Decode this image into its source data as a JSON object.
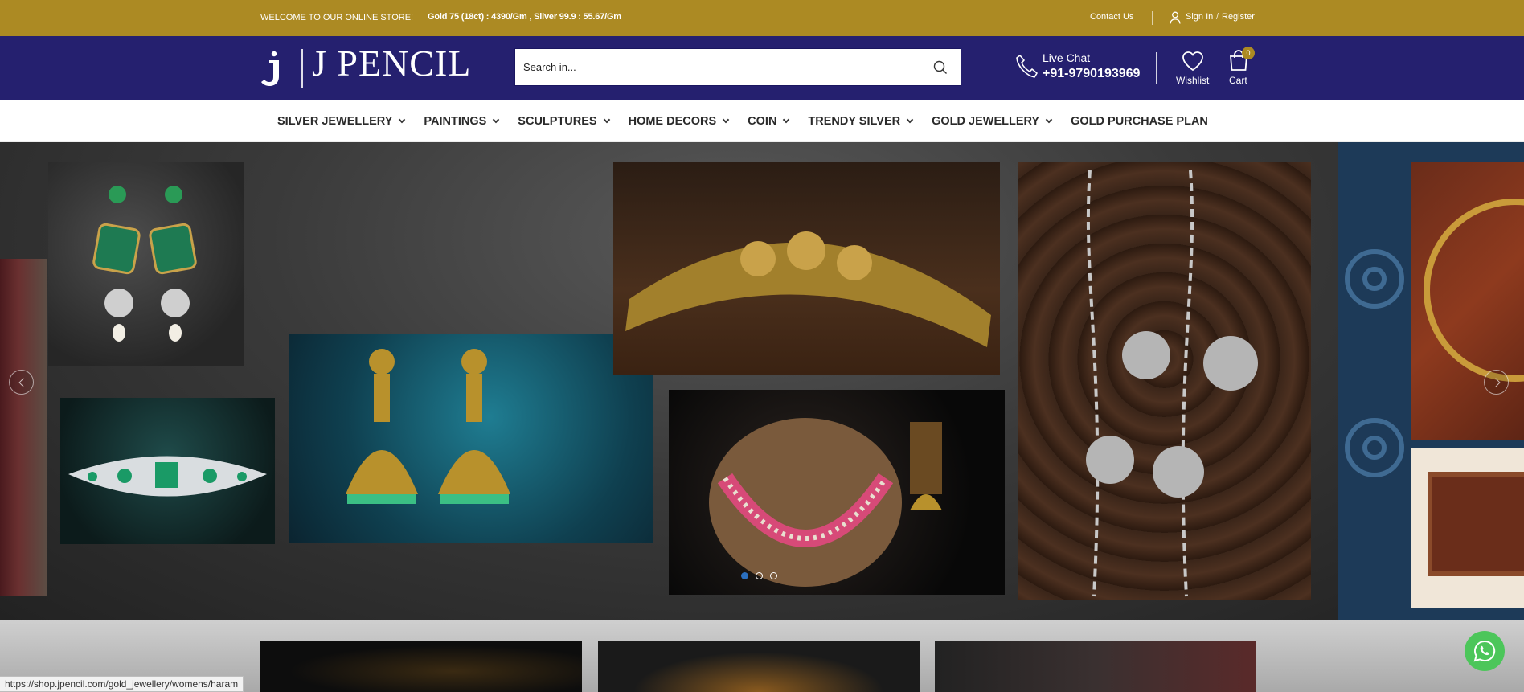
{
  "topbar": {
    "welcome": "WELCOME TO OUR ONLINE STORE!",
    "rates": "Gold 75 (18ct) : 4390/Gm , Silver 99.9 : 55.67/Gm",
    "contact": "Contact Us",
    "signin": "Sign In",
    "separator": "/",
    "register": "Register",
    "user_icon": "user-icon"
  },
  "header": {
    "logo_text": "J PENCIL",
    "search_placeholder": "Search in...",
    "search_icon": "search-icon",
    "live_chat": "Live Chat",
    "phone": "+91-9790193969",
    "wishlist": "Wishlist",
    "cart": "Cart",
    "cart_count": "0"
  },
  "nav": {
    "items": [
      {
        "label": "SILVER JEWELLERY",
        "has_dropdown": true
      },
      {
        "label": "PAINTINGS",
        "has_dropdown": true
      },
      {
        "label": "SCULPTURES",
        "has_dropdown": true
      },
      {
        "label": "HOME DECORS",
        "has_dropdown": true
      },
      {
        "label": "COIN",
        "has_dropdown": true
      },
      {
        "label": "TRENDY SILVER",
        "has_dropdown": true
      },
      {
        "label": "GOLD JEWELLERY",
        "has_dropdown": true
      },
      {
        "label": "GOLD PURCHASE PLAN",
        "has_dropdown": false
      }
    ]
  },
  "hero": {
    "slides_total": 3,
    "active_slide": 1
  },
  "colors": {
    "topbar": "#ac8a23",
    "header": "#25206f",
    "whatsapp": "#4cc65a",
    "active_dot": "#2b6fbf"
  },
  "status_bar": "https://shop.jpencil.com/gold_jewellery/womens/haram"
}
